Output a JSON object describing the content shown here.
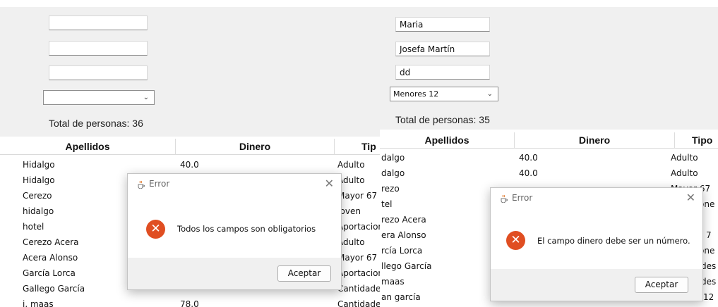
{
  "left": {
    "form": {
      "field_1": "",
      "field_2": "",
      "field_3": "",
      "combo_value": "",
      "total_label": "Total de personas: 36"
    },
    "table": {
      "headers": [
        "Apellidos",
        "Dinero",
        "Tip"
      ],
      "rows": [
        [
          "Hidalgo",
          "40.0",
          "Adulto"
        ],
        [
          "Hidalgo",
          "",
          "Adulto"
        ],
        [
          "Cerezo",
          "",
          "Mayor 67"
        ],
        [
          "hidalgo",
          "",
          "Joven"
        ],
        [
          "hotel",
          "",
          "Aportacion"
        ],
        [
          "Cerezo Acera",
          "",
          "Adulto"
        ],
        [
          "Acera Alonso",
          "",
          "Mayor 67"
        ],
        [
          "García Lorca",
          "",
          "Aportacion"
        ],
        [
          "Gallego García",
          "",
          "Cantidades"
        ],
        [
          "j. maas",
          "78.0",
          "Cantidades"
        ]
      ]
    },
    "dialog": {
      "title": "Error",
      "message": "Todos los campos son obligatorios",
      "button": "Aceptar"
    }
  },
  "right": {
    "form": {
      "field_1": "Maria",
      "field_2": "Josefa Martín",
      "field_3": "dd",
      "combo_value": "Menores 12",
      "total_label": "Total de personas: 35"
    },
    "table": {
      "headers": [
        "Apellidos",
        "Dinero",
        "Tipo"
      ],
      "rows": [
        [
          "dalgo",
          "40.0",
          "Adulto"
        ],
        [
          "dalgo",
          "40.0",
          "Adulto"
        ],
        [
          "rezo",
          "",
          "Mayor 67"
        ],
        [
          "tel",
          "",
          "one"
        ],
        [
          "rezo Acera",
          "",
          ""
        ],
        [
          "era Alonso",
          "",
          "7"
        ],
        [
          "rcía Lorca",
          "",
          "one"
        ],
        [
          "llego García",
          "",
          "des"
        ],
        [
          "maas",
          "",
          "des"
        ],
        [
          "an garcía",
          "",
          "12"
        ]
      ]
    },
    "dialog": {
      "title": "Error",
      "message": "El campo dinero debe ser un número.",
      "button": "Aceptar"
    }
  }
}
